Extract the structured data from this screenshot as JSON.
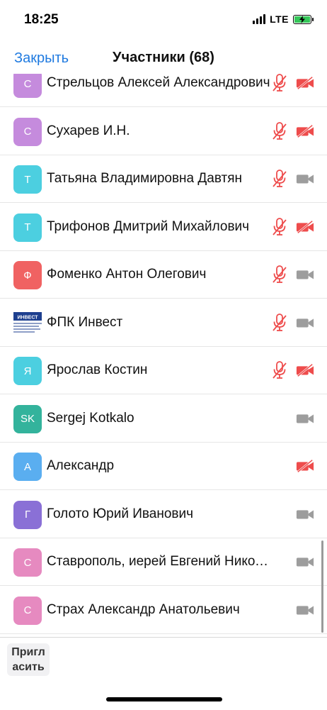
{
  "status": {
    "time": "18:25",
    "network": "LTE"
  },
  "nav": {
    "close_label": "Закрыть",
    "title": "Участники (68)"
  },
  "colors": {
    "accent": "#1f7ae0",
    "muted_red": "#ee4c4c",
    "icon_gray": "#9d9d9d"
  },
  "participants": [
    {
      "initial": "С",
      "name": "Стрельцов Алексей Александрович",
      "avatar_color": "#c58bdd",
      "mic_muted": true,
      "video_off": true
    },
    {
      "initial": "С",
      "name": "Сухарев И.Н.",
      "avatar_color": "#c58bdd",
      "mic_muted": true,
      "video_off": true
    },
    {
      "initial": "Т",
      "name": "Татьяна Владимировна Давтян",
      "avatar_color": "#4ccfe0",
      "mic_muted": true,
      "video_off": false
    },
    {
      "initial": "Т",
      "name": "Трифонов Дмитрий Михайлович",
      "avatar_color": "#4ccfe0",
      "mic_muted": true,
      "video_off": true
    },
    {
      "initial": "Ф",
      "name": "Фоменко Антон Олегович",
      "avatar_color": "#f06262",
      "mic_muted": true,
      "video_off": false
    },
    {
      "initial": "",
      "name": "ФПК Инвест",
      "avatar_color": "#ffffff",
      "logo": true,
      "logo_text": "ИНВЕСТ",
      "mic_muted": true,
      "video_off": false
    },
    {
      "initial": "Я",
      "name": "Ярослав Костин",
      "avatar_color": "#4ccfe0",
      "mic_muted": true,
      "video_off": true
    },
    {
      "initial": "SK",
      "name": "Sergej Kotkalo",
      "avatar_color": "#33b39c",
      "mic_muted": false,
      "video_off": false
    },
    {
      "initial": "А",
      "name": "Александр",
      "avatar_color": "#5aaef0",
      "mic_muted": false,
      "video_off": true
    },
    {
      "initial": "Г",
      "name": "Голото Юрий Иванович",
      "avatar_color": "#8a70d6",
      "mic_muted": false,
      "video_off": false
    },
    {
      "initial": "С",
      "name": "Ставрополь, иерей Евгений Николаевич",
      "avatar_color": "#e68ac0",
      "mic_muted": false,
      "video_off": false
    },
    {
      "initial": "С",
      "name": "Страх Александр Анатольевич",
      "avatar_color": "#e68ac0",
      "mic_muted": false,
      "video_off": false
    }
  ],
  "footer": {
    "invite_label": "Пригласить",
    "invite_line1": "Пригл",
    "invite_line2": "асить"
  }
}
